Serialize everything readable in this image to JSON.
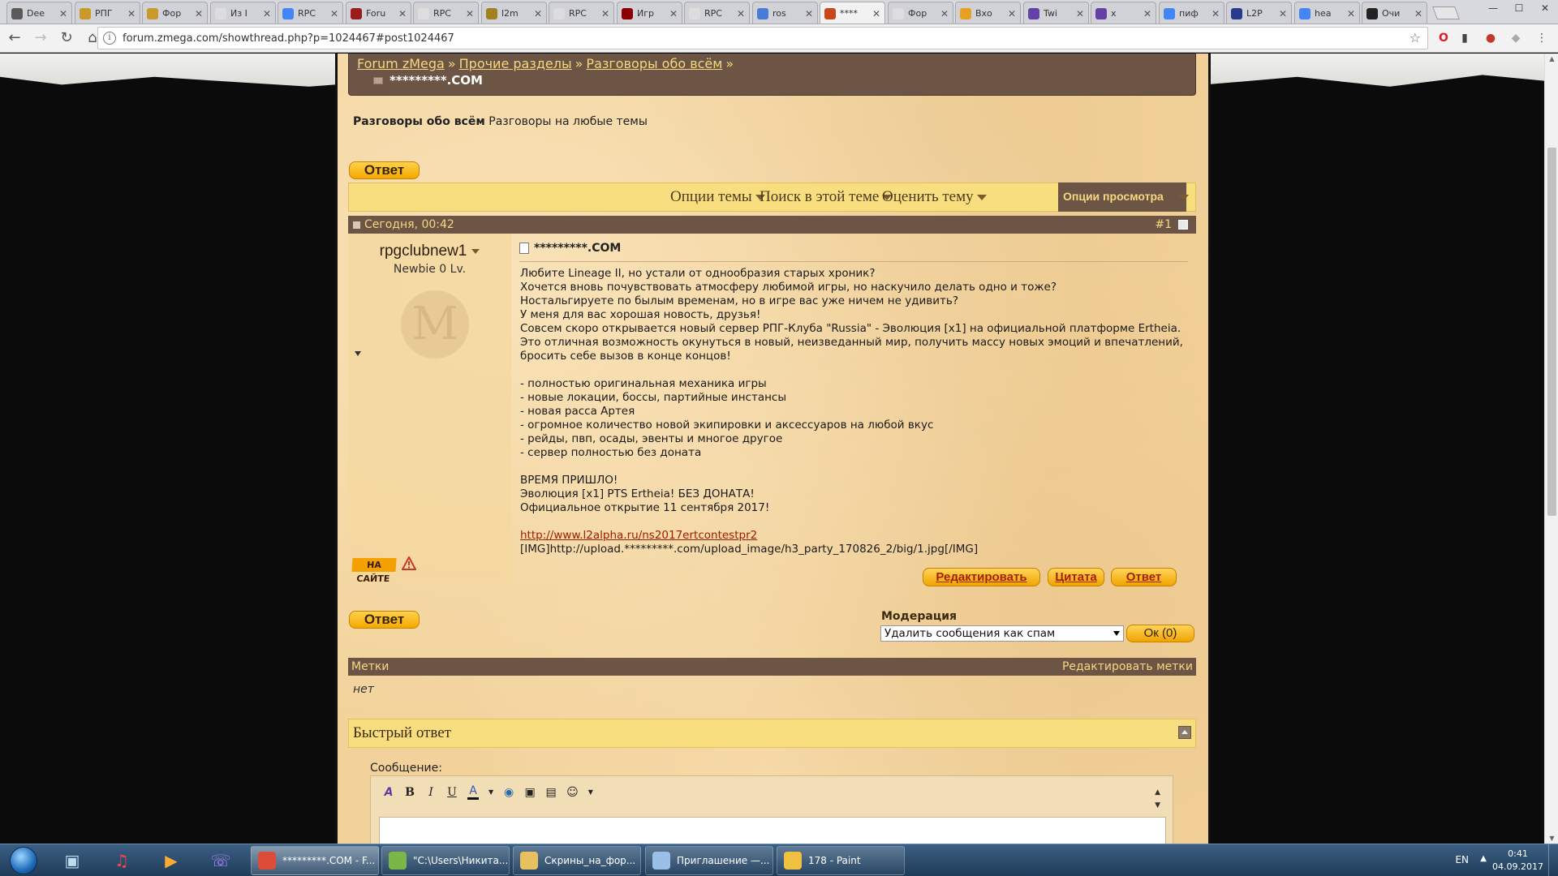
{
  "browser": {
    "tabs": [
      {
        "label": "Dee",
        "color": "#5a5a5a"
      },
      {
        "label": "РПГ",
        "color": "#c99a2a"
      },
      {
        "label": "Фор",
        "color": "#c99a2a"
      },
      {
        "label": "Из I",
        "color": "#dddddd"
      },
      {
        "label": "RPC",
        "color": "#4285f4"
      },
      {
        "label": "Foru",
        "color": "#9b1c1c"
      },
      {
        "label": "RPC",
        "color": "#dddddd"
      },
      {
        "label": "l2m",
        "color": "#a08020"
      },
      {
        "label": "RPC",
        "color": "#dddddd"
      },
      {
        "label": "Игр",
        "color": "#8b0000"
      },
      {
        "label": "RPC",
        "color": "#dddddd"
      },
      {
        "label": "ros",
        "color": "#4a7bd6"
      },
      {
        "label": "****",
        "color": "#c9461d"
      },
      {
        "label": "Фор",
        "color": "#dddddd"
      },
      {
        "label": "Вхо",
        "color": "#e8a020"
      },
      {
        "label": "Twi",
        "color": "#6441a4"
      },
      {
        "label": "x",
        "color": "#6441a4"
      },
      {
        "label": "пиф",
        "color": "#4285f4"
      },
      {
        "label": "L2P",
        "color": "#2a3a8a"
      },
      {
        "label": "hea",
        "color": "#4285f4"
      },
      {
        "label": "Очи",
        "color": "#222222"
      }
    ],
    "active_tab_index": 12,
    "url": "forum.zmega.com/showthread.php?p=1024467#post1024467"
  },
  "breadcrumb": {
    "items": [
      "Forum zMega",
      "Прочие разделы",
      "Разговоры обо всём"
    ],
    "separator": "»",
    "current": "*********.COM"
  },
  "forum_description": {
    "name": "Разговоры обо всём",
    "text": "Разговоры на любые темы"
  },
  "reply_label": "Ответ",
  "thread_toolbar": {
    "options": "Опции темы",
    "search": "Поиск в этой теме",
    "rate": "Оценить тему",
    "view": "Опции просмотра"
  },
  "post": {
    "date": "Сегодня, 00:42",
    "number": "#1",
    "username": "rpgclubnew1",
    "rank": "Newbie 0 Lv.",
    "avatar_letter": "M",
    "online_badge": "НА САЙТЕ",
    "title": "*********.COM",
    "body": [
      "Любите Lineage II, но устали от однообразия старых хроник?",
      "Хочется вновь почувствовать атмосферу любимой игры, но наскучило делать одно и тоже?",
      "Ностальгируете по былым временам, но в игре вас уже ничем не удивить?",
      "У меня для вас хорошая новость, друзья!",
      "Совсем скоро открывается новый сервер РПГ-Клуба \"Russia\" - Эволюция [x1] на официальной платформе Ertheia.",
      "Это отличная возможность окунуться в новый, неизведанный мир, получить массу новых эмоций и впечатлений,",
      "бросить себе вызов в конце концов!",
      "",
      "- полностью оригинальная механика игры",
      "- новые локации, боссы, партийные инстансы",
      "- новая расса Артея",
      "- огромное количество новой экипировки и аксессуаров на любой вкус",
      "- рейды, пвп, осады, эвенты и многое другое",
      "- сервер полностью без доната",
      "",
      "ВРЕМЯ ПРИШЛО!",
      "Эволюция [x1] PTS Ertheia! БЕЗ ДОНАТА!",
      "Официальное открытие 11 сентября 2017!",
      ""
    ],
    "link": "http://www.l2alpha.ru/ns2017ertcontestpr2",
    "img_code": "[IMG]http://upload.*********.com/upload_image/h3_party_170826_2/big/1.jpg[/IMG]",
    "actions": {
      "edit": "Редактировать",
      "quote": "Цитата",
      "reply": "Ответ"
    }
  },
  "moderation": {
    "label": "Модерация",
    "selected": "Удалить сообщения как спам",
    "ok": "Ок (0)"
  },
  "tags": {
    "label": "Метки",
    "edit": "Редактировать метки",
    "value": "нет"
  },
  "quick_reply": {
    "title": "Быстрый ответ",
    "message_label": "Сообщение:"
  },
  "taskbar": {
    "tasks": [
      {
        "label": "*********.COM - F...",
        "color": "#dd4b39"
      },
      {
        "label": "\"C:\\Users\\Никита...",
        "color": "#7ab648"
      },
      {
        "label": "Скрины_на_фор...",
        "color": "#e8c060"
      },
      {
        "label": "Приглашение —...",
        "color": "#9ac0e8"
      },
      {
        "label": "178 - Paint",
        "color": "#f0c040"
      }
    ],
    "lang": "EN",
    "time": "0:41",
    "date": "04.09.2017"
  }
}
